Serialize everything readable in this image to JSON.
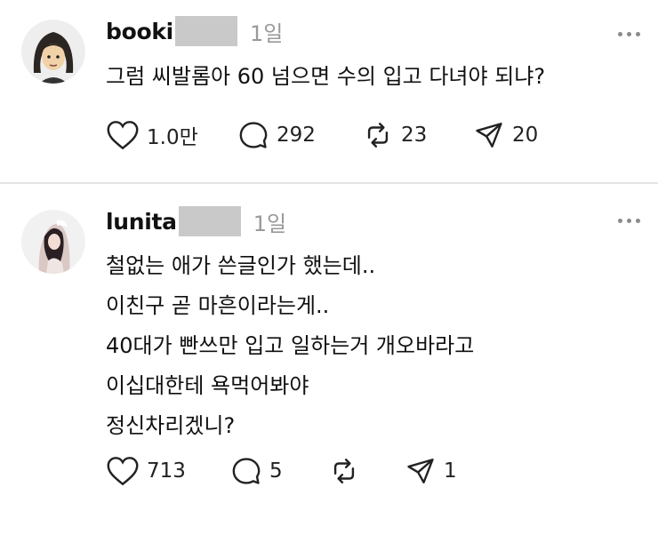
{
  "posts": [
    {
      "username": "booki",
      "time": "1일",
      "text": "그럼 씨발롬아 60 넘으면 수의 입고 다녀야 되냐?",
      "stats": {
        "likes": "1.0만",
        "comments": "292",
        "reposts": "23",
        "shares": "20"
      },
      "avatar_icon": "cartoon-person-icon"
    },
    {
      "username": "lunita",
      "time": "1일",
      "text": "철없는 애가 쓴글인가 했는데..\n이친구 곧 마흔이라는게..\n40대가 빤쓰만 입고 일하는거 개오바라고\n이십대한테 욕먹어봐야\n정신차리겠니?",
      "stats": {
        "likes": "713",
        "comments": "5",
        "reposts": "",
        "shares": "1"
      },
      "avatar_icon": "profile-photo-icon"
    }
  ],
  "icons": {
    "like": "heart-icon",
    "comment": "comment-bubble-icon",
    "repost": "repost-arrows-icon",
    "share": "send-paper-plane-icon",
    "more": "more-dots-icon"
  },
  "colors": {
    "redaction": "#c9c9c9",
    "muted_text": "#999999",
    "divider": "#e4e4e4"
  }
}
